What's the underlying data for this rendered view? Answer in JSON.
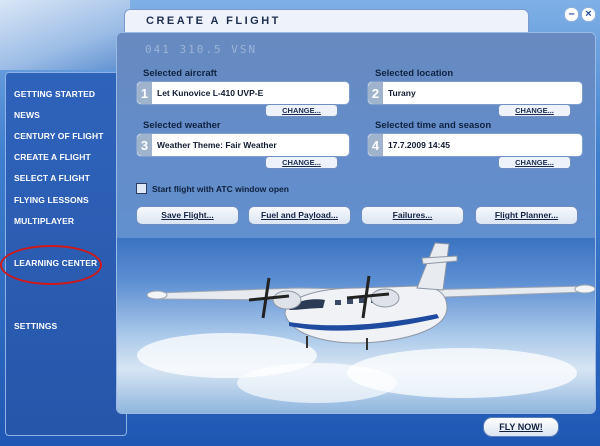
{
  "window": {
    "min_label": "–",
    "close_label": "×"
  },
  "header": {
    "title": "CREATE A FLIGHT",
    "bg_text": "041 310.5 VSN"
  },
  "sidebar": {
    "items": [
      {
        "label": "GETTING STARTED"
      },
      {
        "label": "NEWS"
      },
      {
        "label": "CENTURY OF FLIGHT"
      },
      {
        "label": "CREATE A FLIGHT"
      },
      {
        "label": "SELECT A FLIGHT"
      },
      {
        "label": "FLYING LESSONS"
      },
      {
        "label": "MULTIPLAYER"
      },
      {
        "label": "LEARNING CENTER"
      },
      {
        "label": "SETTINGS"
      }
    ]
  },
  "aircraft": {
    "label": "Selected aircraft",
    "num": "1",
    "value": "Let Kunovice L-410 UVP-E",
    "change": "CHANGE..."
  },
  "location": {
    "label": "Selected location",
    "num": "2",
    "value": "Turany",
    "change": "CHANGE..."
  },
  "weather": {
    "label": "Selected weather",
    "num": "3",
    "value": "Weather Theme: Fair Weather",
    "change": "CHANGE..."
  },
  "time": {
    "label": "Selected time and season",
    "num": "4",
    "value": "17.7.2009 14:45",
    "change": "CHANGE..."
  },
  "atc": {
    "label": "Start flight with ATC window open"
  },
  "actions": {
    "save": "Save Flight...",
    "fuel": "Fuel and Payload...",
    "failures": "Failures...",
    "planner": "Flight Planner..."
  },
  "fly_now": "FLY NOW!",
  "colors": {
    "annotation": "#d01818",
    "accent": "#2656aa"
  }
}
